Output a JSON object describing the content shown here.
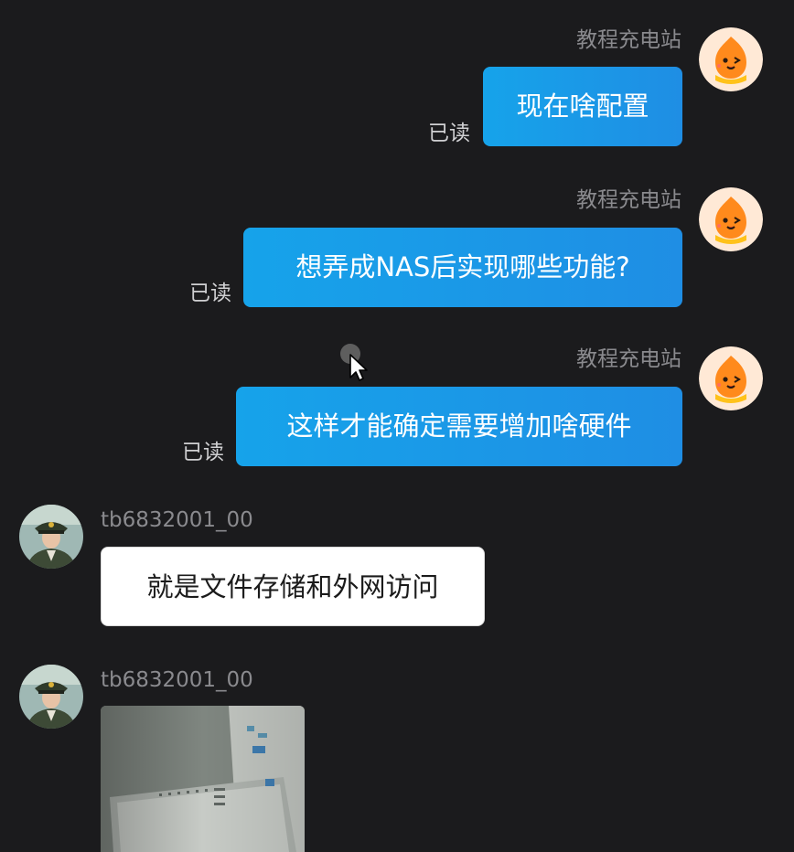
{
  "messages": [
    {
      "sender": "教程充电站",
      "text": "现在啥配置",
      "status": "已读"
    },
    {
      "sender": "教程充电站",
      "text": "想弄成NAS后实现哪些功能?",
      "status": "已读"
    },
    {
      "sender": "教程充电站",
      "text": "这样才能确定需要增加啥硬件",
      "status": "已读"
    },
    {
      "sender": "tb6832001_00",
      "text": "就是文件存储和外网访问"
    },
    {
      "sender": "tb6832001_00",
      "image": "photo-of-screen"
    }
  ],
  "colors": {
    "background": "#1b1b1d",
    "outgoing_bubble": "#1a9be8",
    "incoming_bubble": "#ffffff",
    "name_text": "#8a8a8e"
  },
  "icons": {
    "agent_avatar": "orange-mascot-avatar",
    "user_avatar": "uniform-portrait-avatar",
    "cursor": "mouse-pointer-icon"
  }
}
